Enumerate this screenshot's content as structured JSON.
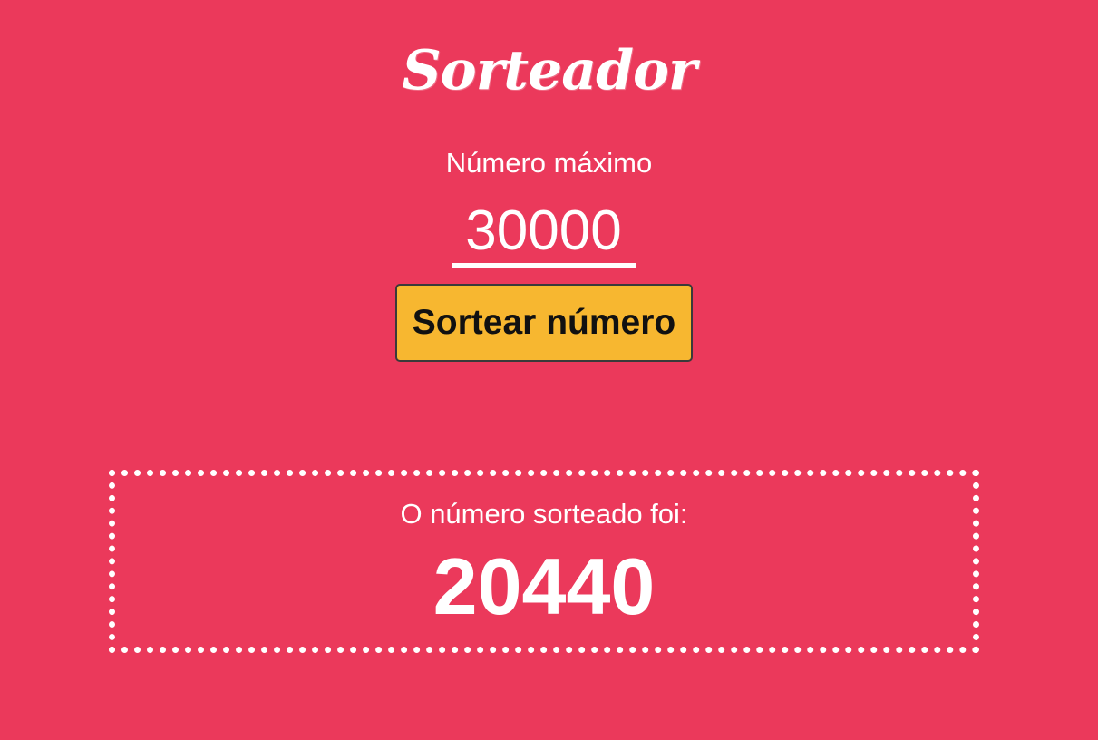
{
  "app": {
    "title": "Sorteador",
    "background_color": "#EB395B",
    "button_color": "#F7B730"
  },
  "form": {
    "max_label": "Número máximo",
    "max_value": "30000",
    "draw_button_label": "Sortear número"
  },
  "result": {
    "label": "O número sorteado foi:",
    "value": "20440"
  }
}
